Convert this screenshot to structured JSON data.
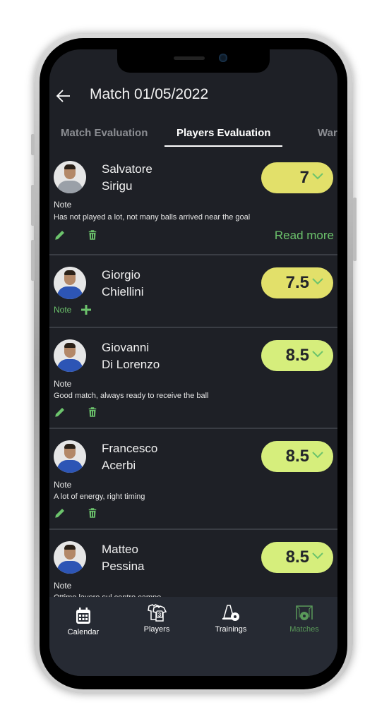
{
  "header": {
    "title": "Match 01/05/2022"
  },
  "tabs": [
    {
      "label": "Match Evaluation",
      "active": false
    },
    {
      "label": "Players Evaluation",
      "active": true
    },
    {
      "label": "War",
      "active": false
    }
  ],
  "players": [
    {
      "first": "Salvatore",
      "last": "Sirigu",
      "rating": "7",
      "note_label": "Note",
      "note": "Has not played a lot, not many balls arrived near the goal",
      "read_more": "Read more",
      "shirt": "#9aa0a8"
    },
    {
      "first": "Giorgio",
      "last": "Chiellini",
      "rating": "7.5",
      "note_add_label": "Note",
      "shirt": "#2d55b5"
    },
    {
      "first": "Giovanni",
      "last": "Di Lorenzo",
      "rating": "8.5",
      "note_label": "Note",
      "note": "Good match, always ready to receive the ball",
      "shirt": "#2d55b5"
    },
    {
      "first": "Francesco",
      "last": "Acerbi",
      "rating": "8.5",
      "note_label": "Note",
      "note": "A lot of energy, right timing",
      "shirt": "#2d55b5"
    },
    {
      "first": "Matteo",
      "last": "Pessina",
      "rating": "8.5",
      "note_label": "Note",
      "note": "Ottimo lavoro sul centro campo",
      "shirt": "#2d55b5"
    }
  ],
  "nav": [
    {
      "label": "Calendar",
      "active": false
    },
    {
      "label": "Players",
      "active": false
    },
    {
      "label": "Trainings",
      "active": false
    },
    {
      "label": "Matches",
      "active": true
    }
  ],
  "colors": {
    "accent": "#6cc36c",
    "rating_yellow": "#e2e06a",
    "rating_green": "#d6ee7c",
    "background": "#1e2026",
    "nav_background": "#262a33"
  }
}
